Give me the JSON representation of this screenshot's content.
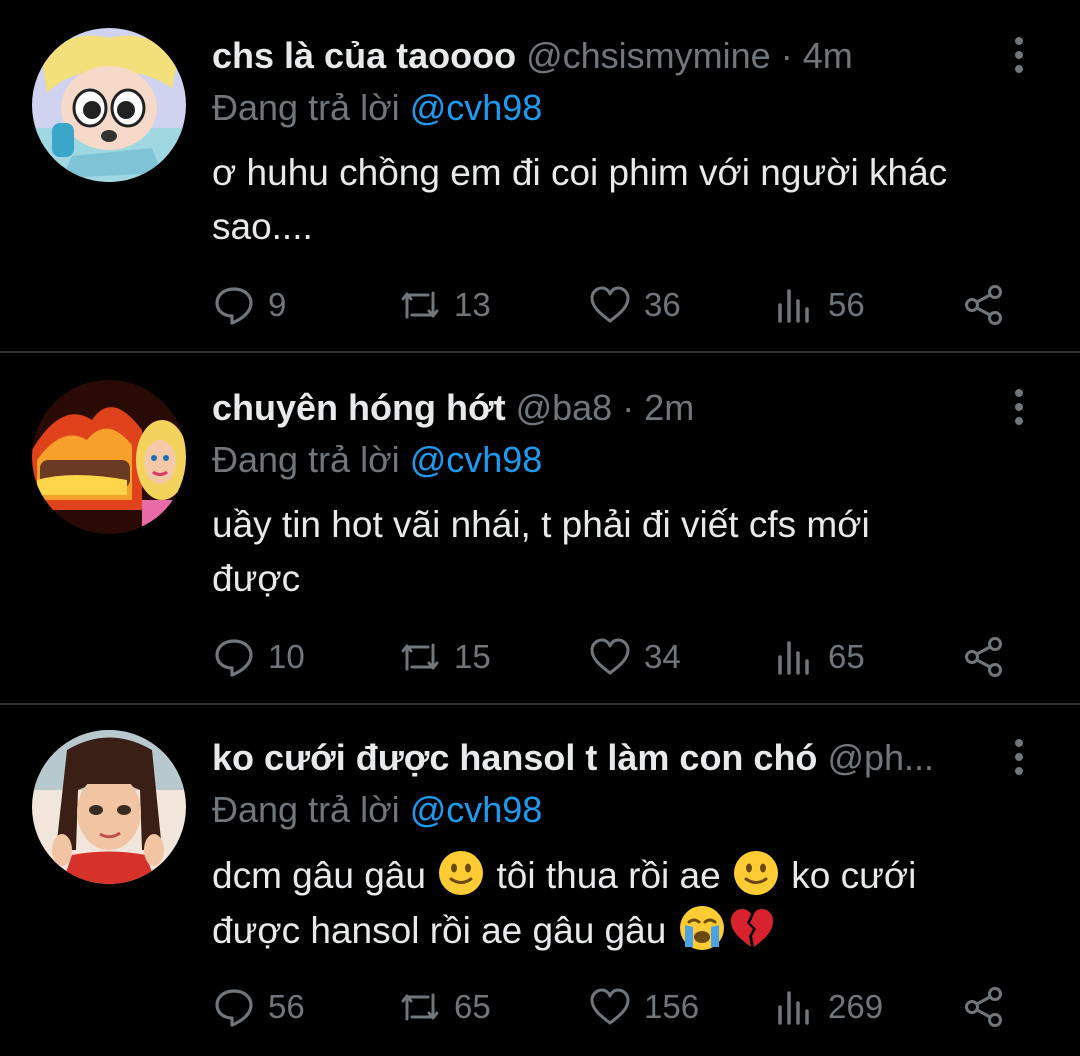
{
  "tweets": [
    {
      "name": "chs là của taoooo",
      "handle": "@chsismymine",
      "separator": "·",
      "time": "4m",
      "reply_prefix": "Đang trả lời",
      "reply_to": "@cvh98",
      "text_line1": "ơ huhu chồng em đi coi phim với người khác",
      "text_line2": "sao....",
      "replies": "9",
      "retweets": "13",
      "likes": "36",
      "views": "56"
    },
    {
      "name": "chuyên hóng hớt",
      "handle": "@ba8",
      "separator": "·",
      "time": "2m",
      "reply_prefix": "Đang trả lời",
      "reply_to": "@cvh98",
      "text_line1": "uầy tin hot vãi nhái, t phải đi viết cfs mới",
      "text_line2": "được",
      "replies": "10",
      "retweets": "15",
      "likes": "34",
      "views": "65"
    },
    {
      "name": "ko cưới được hansol t làm con chó",
      "handle": "@ph...",
      "reply_prefix": "Đang trả lời",
      "reply_to": "@cvh98",
      "text_part1": "dcm gâu gâu",
      "text_part2": "tôi thua rồi ae",
      "text_part3": "ko cưới",
      "text_part4": "được hansol rồi ae gâu gâu",
      "replies": "56",
      "retweets": "65",
      "likes": "156",
      "views": "269"
    }
  ],
  "icons": {
    "reply": "speech-bubble-icon",
    "retweet": "retweet-icon",
    "like": "heart-icon",
    "views": "bar-chart-icon",
    "share": "share-icon",
    "more": "vertical-dots-icon",
    "emoji_smile": "slightly-smiling-face-emoji",
    "emoji_cry": "loudly-crying-face-emoji",
    "emoji_heart": "broken-heart-emoji"
  },
  "colors": {
    "background": "#000000",
    "text": "#e7e9ea",
    "muted": "#71767b",
    "mention": "#1d9bf0",
    "divider": "#2f3336"
  }
}
